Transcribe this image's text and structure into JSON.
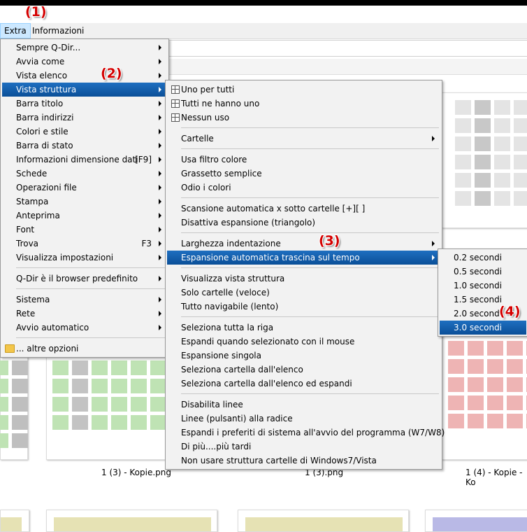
{
  "menubar": {
    "extra": "Extra",
    "informazioni": "Informazioni"
  },
  "annotations": [
    "(1)",
    "(2)",
    "(3)",
    "(4)"
  ],
  "extra_menu": {
    "items": [
      {
        "label": "Sempre Q-Dir...",
        "submenu": true
      },
      {
        "label": "Avvia come",
        "submenu": true
      },
      {
        "label": "Vista elenco",
        "submenu": true
      },
      {
        "label": "Vista struttura",
        "submenu": true,
        "highlighted": true
      },
      {
        "label": "Barra titolo",
        "submenu": true
      },
      {
        "label": "Barra indirizzi",
        "submenu": true
      },
      {
        "label": "Colori e stile",
        "submenu": true
      },
      {
        "label": "Barra di stato",
        "submenu": true
      },
      {
        "label": "Informazioni dimensione dati",
        "shortcut": "[F9]",
        "submenu": true
      },
      {
        "label": "Schede",
        "submenu": true
      },
      {
        "label": "Operazioni file",
        "submenu": true
      },
      {
        "label": "Stampa",
        "submenu": true
      },
      {
        "label": "Anteprima",
        "submenu": true
      },
      {
        "label": "Font",
        "submenu": true
      },
      {
        "label": "Trova",
        "shortcut": "F3",
        "submenu": true
      },
      {
        "label": "Visualizza impostazioni",
        "submenu": true
      },
      {
        "label": "Q-Dir è il browser predefinito",
        "submenu": true
      },
      {
        "label": "Sistema",
        "submenu": true
      },
      {
        "label": "Rete",
        "submenu": true
      },
      {
        "label": "Avvio automatico",
        "submenu": true
      },
      {
        "label": "... altre opzioni",
        "submenu": false
      }
    ]
  },
  "struttura_menu": {
    "items": [
      {
        "label": "Uno per tutti",
        "icon": "grid-icon"
      },
      {
        "label": "Tutti ne hanno uno",
        "icon": "grid-icon"
      },
      {
        "label": "Nessun uso",
        "icon": "grid-icon"
      },
      {
        "label": "Cartelle",
        "submenu": true
      },
      {
        "label": "Usa filtro colore"
      },
      {
        "label": "Grassetto semplice"
      },
      {
        "label": "Odio i colori"
      },
      {
        "label": "Scansione automatica x sotto cartelle [+][ ]"
      },
      {
        "label": "Disattiva espansione (triangolo)"
      },
      {
        "label": "Larghezza indentazione",
        "submenu": true
      },
      {
        "label": "Espansione automatica trascina sul tempo",
        "submenu": true,
        "highlighted": true
      },
      {
        "label": "Visualizza vista struttura"
      },
      {
        "label": "Solo cartelle (veloce)"
      },
      {
        "label": "Tutto navigabile (lento)"
      },
      {
        "label": "Seleziona tutta la riga"
      },
      {
        "label": "Espandi quando selezionato con il mouse"
      },
      {
        "label": "Espansione singola"
      },
      {
        "label": "Seleziona cartella dall'elenco"
      },
      {
        "label": "Seleziona cartella dall'elenco ed espandi"
      },
      {
        "label": "Disabilita linee"
      },
      {
        "label": "Linee (pulsanti) alla radice"
      },
      {
        "label": "Espandi i preferiti di sistema all'avvio del programma (W7/W8)"
      },
      {
        "label": "Di più....più tardi"
      },
      {
        "label": "Non usare struttura cartelle di Windows7/Vista"
      }
    ]
  },
  "tempo_menu": {
    "items": [
      {
        "label": "0.2 secondi"
      },
      {
        "label": "0.5 secondi"
      },
      {
        "label": "1.0 secondi"
      },
      {
        "label": "1.5 secondi"
      },
      {
        "label": "2.0 secondi"
      },
      {
        "label": "3.0 secondi",
        "highlighted": true
      }
    ]
  },
  "files": [
    "1 (3) - Kopie.png",
    "1 (3).png",
    "1 (4) - Kopie - Ko"
  ],
  "colors": {
    "highlight": "#0c5aa6",
    "annotation": "#d40000",
    "thumb_gray": "#c8c8c8",
    "thumb_green": "#bfe3b4",
    "thumb_red": "#eeb4b4",
    "thumb_yellow": "#e6e2b4",
    "thumb_blue": "#b9b9e6"
  }
}
